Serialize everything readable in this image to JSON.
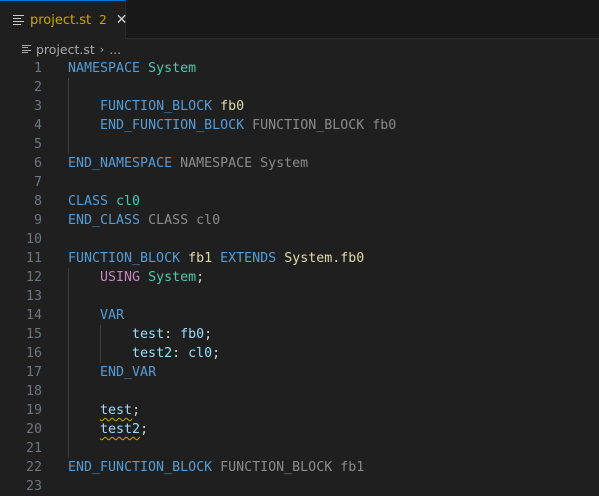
{
  "tab": {
    "name": "project.st",
    "problems": "2",
    "close": "✕"
  },
  "breadcrumb": {
    "file": "project.st",
    "sep": "›",
    "more": "..."
  },
  "lines": [
    {
      "n": "1",
      "t": [
        [
          "kw",
          "NAMESPACE"
        ],
        [
          "pl",
          " "
        ],
        [
          "ty",
          "System"
        ]
      ]
    },
    {
      "n": "2",
      "t": []
    },
    {
      "n": "3",
      "t": [
        [
          "pl",
          "    "
        ],
        [
          "kw",
          "FUNCTION_BLOCK"
        ],
        [
          "pl",
          " "
        ],
        [
          "fn",
          "fb0"
        ]
      ]
    },
    {
      "n": "4",
      "t": [
        [
          "pl",
          "    "
        ],
        [
          "kw",
          "END_FUNCTION_BLOCK"
        ],
        [
          "pl",
          " "
        ],
        [
          "hint",
          "FUNCTION_BLOCK fb0"
        ]
      ]
    },
    {
      "n": "5",
      "t": []
    },
    {
      "n": "6",
      "t": [
        [
          "kw",
          "END_NAMESPACE"
        ],
        [
          "pl",
          " "
        ],
        [
          "hint",
          "NAMESPACE System"
        ]
      ]
    },
    {
      "n": "7",
      "t": []
    },
    {
      "n": "8",
      "t": [
        [
          "kw",
          "CLASS"
        ],
        [
          "pl",
          " "
        ],
        [
          "ty",
          "cl0"
        ]
      ]
    },
    {
      "n": "9",
      "t": [
        [
          "kw",
          "END_CLASS"
        ],
        [
          "pl",
          " "
        ],
        [
          "hint",
          "CLASS cl0"
        ]
      ]
    },
    {
      "n": "10",
      "t": []
    },
    {
      "n": "11",
      "t": [
        [
          "kw",
          "FUNCTION_BLOCK"
        ],
        [
          "pl",
          " "
        ],
        [
          "fn",
          "fb1"
        ],
        [
          "pl",
          " "
        ],
        [
          "kw",
          "EXTENDS"
        ],
        [
          "pl",
          " "
        ],
        [
          "fn",
          "System"
        ],
        [
          "pl",
          "."
        ],
        [
          "fn",
          "fb0"
        ]
      ]
    },
    {
      "n": "12",
      "t": [
        [
          "pl",
          "    "
        ],
        [
          "ctl",
          "USING"
        ],
        [
          "pl",
          " "
        ],
        [
          "ty",
          "System"
        ],
        [
          "pl",
          ";"
        ]
      ]
    },
    {
      "n": "13",
      "t": []
    },
    {
      "n": "14",
      "t": [
        [
          "pl",
          "    "
        ],
        [
          "kw",
          "VAR"
        ]
      ]
    },
    {
      "n": "15",
      "t": [
        [
          "pl",
          "        "
        ],
        [
          "var",
          "test"
        ],
        [
          "pl",
          ": "
        ],
        [
          "var",
          "fb0"
        ],
        [
          "pl",
          ";"
        ]
      ]
    },
    {
      "n": "16",
      "t": [
        [
          "pl",
          "        "
        ],
        [
          "var",
          "test2"
        ],
        [
          "pl",
          ": "
        ],
        [
          "var",
          "cl0"
        ],
        [
          "pl",
          ";"
        ]
      ]
    },
    {
      "n": "17",
      "t": [
        [
          "pl",
          "    "
        ],
        [
          "kw",
          "END_VAR"
        ]
      ]
    },
    {
      "n": "18",
      "t": []
    },
    {
      "n": "19",
      "t": [
        [
          "pl",
          "    "
        ],
        [
          "var sq",
          "test"
        ],
        [
          "pl",
          ";"
        ]
      ]
    },
    {
      "n": "20",
      "t": [
        [
          "pl",
          "    "
        ],
        [
          "var sq",
          "test2"
        ],
        [
          "pl",
          ";"
        ]
      ]
    },
    {
      "n": "21",
      "t": []
    },
    {
      "n": "22",
      "t": [
        [
          "kw",
          "END_FUNCTION_BLOCK"
        ],
        [
          "pl",
          " "
        ],
        [
          "hint",
          "FUNCTION_BLOCK fb1"
        ]
      ]
    },
    {
      "n": "23",
      "t": []
    }
  ]
}
